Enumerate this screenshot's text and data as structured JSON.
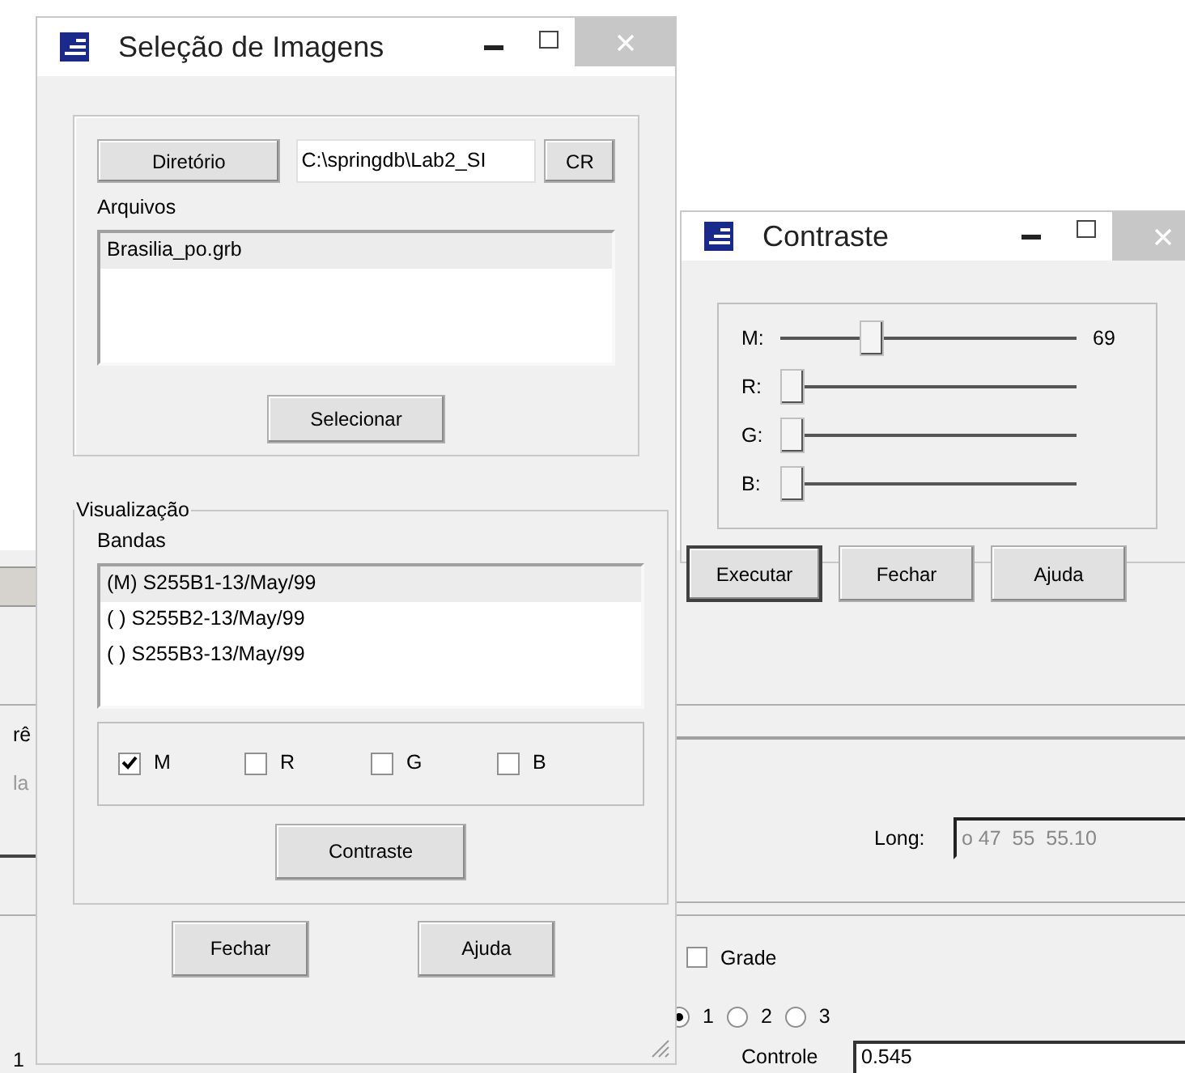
{
  "background_window": {
    "left_texts": [
      "rê",
      "la",
      "1"
    ],
    "long": {
      "label": "Long:",
      "value": "o 47  55  55.10"
    },
    "grade": {
      "label": "Grade",
      "checked": false
    },
    "radios": [
      {
        "label": "1",
        "selected": true
      },
      {
        "label": "2",
        "selected": false
      },
      {
        "label": "3",
        "selected": false
      }
    ],
    "controle": {
      "label": "Controle",
      "value": "0.545"
    }
  },
  "selecao_window": {
    "title": "Seleção de Imagens",
    "directory_button": "Diretório",
    "directory_path": "C:\\springdb\\Lab2_SI",
    "cr_button": "CR",
    "files_label": "Arquivos",
    "files": [
      {
        "text": "Brasilia_po.grb",
        "selected": true
      }
    ],
    "select_button": "Selecionar",
    "visualization_legend": "Visualização",
    "bands_label": "Bandas",
    "bands": [
      {
        "text": "(M) S255B1-13/May/99",
        "selected": true
      },
      {
        "text": "( ) S255B2-13/May/99",
        "selected": false
      },
      {
        "text": "( ) S255B3-13/May/99",
        "selected": false
      }
    ],
    "channels": [
      {
        "label": "M",
        "checked": true
      },
      {
        "label": "R",
        "checked": false
      },
      {
        "label": "G",
        "checked": false
      },
      {
        "label": "B",
        "checked": false
      }
    ],
    "contrast_button": "Contraste",
    "buttons": [
      "Fechar",
      "Ajuda"
    ]
  },
  "contraste_window": {
    "title": "Contraste",
    "sliders": [
      {
        "label": "M:",
        "level": 0.29,
        "reading": "69"
      },
      {
        "label": "R:",
        "level": 0
      },
      {
        "label": "G:",
        "level": 0
      },
      {
        "label": "B:",
        "level": 0
      }
    ],
    "buttons": [
      {
        "label": "Executar",
        "focused": true
      },
      {
        "label": "Fechar",
        "focused": false
      },
      {
        "label": "Ajuda",
        "focused": false
      }
    ]
  }
}
